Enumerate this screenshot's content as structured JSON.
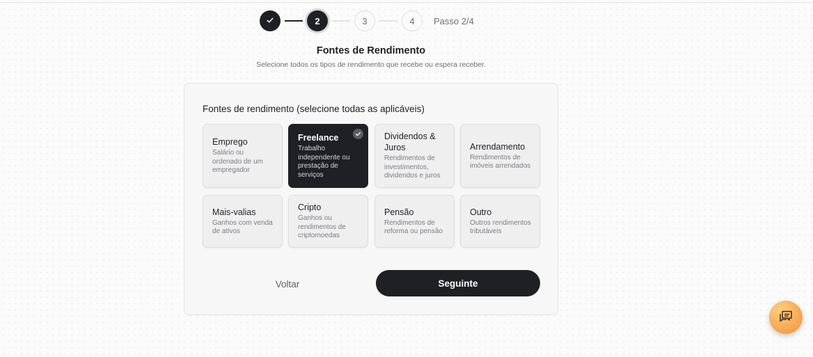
{
  "stepper": {
    "steps": [
      {
        "label": "",
        "state": "done",
        "icon": "check-icon"
      },
      {
        "label": "2",
        "state": "current"
      },
      {
        "label": "3",
        "state": "pending"
      },
      {
        "label": "4",
        "state": "pending"
      }
    ],
    "progress_label": "Passo 2/4"
  },
  "header": {
    "title": "Fontes de Rendimento",
    "subtitle": "Selecione todos os tipos de rendimento que recebe ou espera receber."
  },
  "form": {
    "heading": "Fontes de rendimento (selecione todas as aplicáveis)",
    "options": [
      {
        "title": "Emprego",
        "description": "Salário ou ordenado de um empregador",
        "selected": false
      },
      {
        "title": "Freelance",
        "description": "Trabalho independente ou prestação de serviços",
        "selected": true
      },
      {
        "title": "Dividendos & Juros",
        "description": "Rendimentos de investimentos, dividendos e juros",
        "selected": false
      },
      {
        "title": "Arrendamento",
        "description": "Rendimentos de imóveis arrendados",
        "selected": false
      },
      {
        "title": "Mais-valias",
        "description": "Ganhos com venda de ativos",
        "selected": false
      },
      {
        "title": "Cripto",
        "description": "Ganhos ou rendimentos de criptomoedas",
        "selected": false
      },
      {
        "title": "Pensão",
        "description": "Rendimentos de reforma ou pensão",
        "selected": false
      },
      {
        "title": "Outro",
        "description": "Outros rendimentos tributáveis",
        "selected": false
      }
    ],
    "back_label": "Voltar",
    "next_label": "Seguinte"
  },
  "chat": {
    "icon": "chat-icon",
    "color": "#f7a24e"
  },
  "colors": {
    "primary": "#1f2023",
    "accent": "#f7a24e"
  }
}
